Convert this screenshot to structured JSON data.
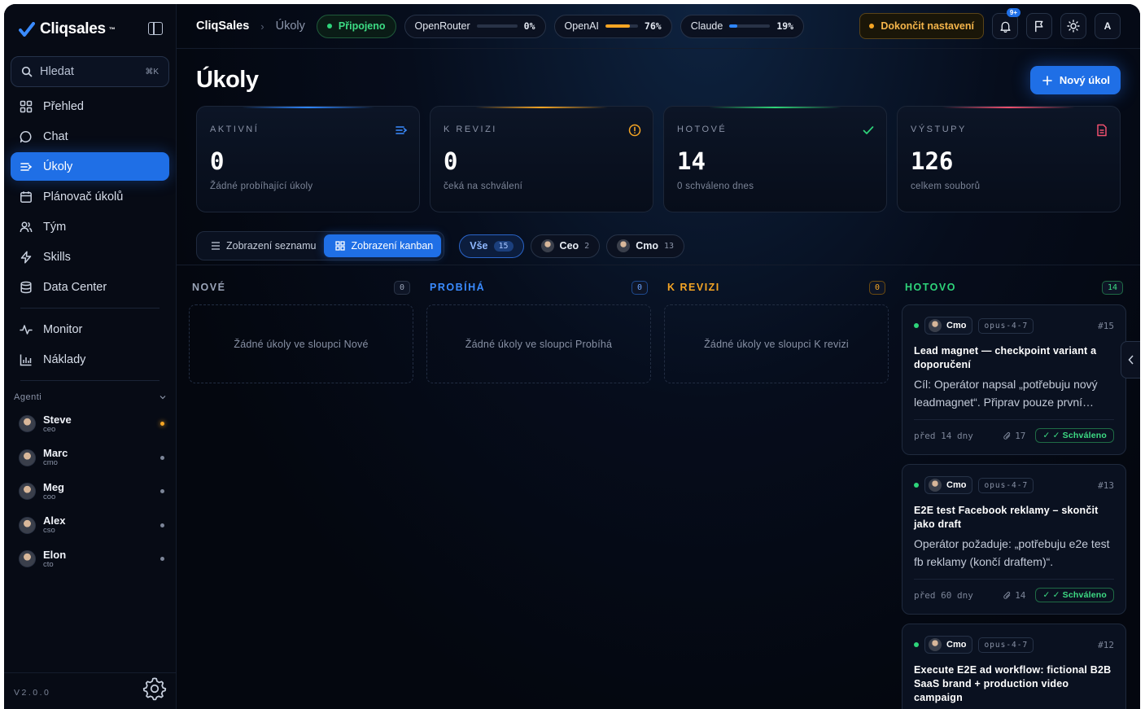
{
  "brand": {
    "name": "Cliqsales",
    "tm": "™"
  },
  "search": {
    "label": "Hledat",
    "shortcut": "⌘K"
  },
  "nav": {
    "items": [
      {
        "label": "Přehled",
        "icon": "grid-icon"
      },
      {
        "label": "Chat",
        "icon": "chat-icon"
      },
      {
        "label": "Úkoly",
        "icon": "tasks-icon",
        "active": true
      },
      {
        "label": "Plánovač úkolů",
        "icon": "calendar-icon"
      },
      {
        "label": "Tým",
        "icon": "team-icon"
      },
      {
        "label": "Skills",
        "icon": "bolt-icon"
      },
      {
        "label": "Data Center",
        "icon": "database-icon"
      }
    ],
    "items2": [
      {
        "label": "Monitor",
        "icon": "pulse-icon"
      },
      {
        "label": "Náklady",
        "icon": "chart-icon"
      }
    ]
  },
  "agents": {
    "title": "Agenti",
    "list": [
      {
        "name": "Steve",
        "role": "ceo",
        "status": "active"
      },
      {
        "name": "Marc",
        "role": "cmo",
        "status": "idle"
      },
      {
        "name": "Meg",
        "role": "coo",
        "status": "idle"
      },
      {
        "name": "Alex",
        "role": "cso",
        "status": "idle"
      },
      {
        "name": "Elon",
        "role": "cto",
        "status": "idle"
      }
    ]
  },
  "version": "V2.0.0",
  "topbar": {
    "crumb1": "CliqSales",
    "crumb2": "Úkoly",
    "connection": "Připojeno",
    "providers": [
      {
        "name": "OpenRouter",
        "pct": "0%",
        "value": 0,
        "color": "#3a7bff"
      },
      {
        "name": "OpenAI",
        "pct": "76%",
        "value": 0.76,
        "color": "#f5a524"
      },
      {
        "name": "Claude",
        "pct": "19%",
        "value": 0.19,
        "color": "#2f86ff"
      }
    ],
    "setup": "Dokončit nastavení",
    "notif_badge": "9+",
    "avatar_letter": "A"
  },
  "page": {
    "title": "Úkoly",
    "new_task": "Nový úkol"
  },
  "stats": [
    {
      "label": "AKTIVNÍ",
      "value": "0",
      "sub": "Žádné probíhající úkoly",
      "color": "#2f86ff",
      "icon": "list-icon"
    },
    {
      "label": "K REVIZI",
      "value": "0",
      "sub": "čeká na schválení",
      "color": "#f5a524",
      "icon": "alert-icon"
    },
    {
      "label": "HOTOVÉ",
      "value": "14",
      "sub": "0 schváleno dnes",
      "color": "#2ed47a",
      "icon": "check-icon"
    },
    {
      "label": "VÝSTUPY",
      "value": "126",
      "sub": "celkem souborů",
      "color": "#f0506e",
      "icon": "file-icon"
    }
  ],
  "view": {
    "list": "Zobrazení seznamu",
    "kanban": "Zobrazení kanban"
  },
  "filters": [
    {
      "label": "Vše",
      "count": "15",
      "selected": true
    },
    {
      "label": "Ceo",
      "count": "2"
    },
    {
      "label": "Cmo",
      "count": "13"
    }
  ],
  "columns": [
    {
      "title": "NOVÉ",
      "count": "0",
      "color": "#9aa4b8",
      "empty": "Žádné úkoly ve sloupci Nové"
    },
    {
      "title": "PROBÍHÁ",
      "count": "0",
      "color": "#3a8bff",
      "empty": "Žádné úkoly ve sloupci Probíhá"
    },
    {
      "title": "K REVIZI",
      "count": "0",
      "color": "#f5a524",
      "empty": "Žádné úkoly ve sloupci K revizi"
    },
    {
      "title": "HOTOVO",
      "count": "14",
      "color": "#2ed47a"
    }
  ],
  "cards": [
    {
      "agent": "Cmo",
      "model": "opus-4-7",
      "id": "#15",
      "title": "Lead magnet — checkpoint variant a doporučení",
      "desc": "Cíl: Operátor napsal „potřebuju nový leadmagnet“. Připrav pouze první…",
      "age": "před 14 dny",
      "files": "17",
      "status": "✓ Schváleno"
    },
    {
      "agent": "Cmo",
      "model": "opus-4-7",
      "id": "#13",
      "title": "E2E test Facebook reklamy – skončit jako draft",
      "desc": "Operátor požaduje: „potřebuju e2e test fb reklamy (končí draftem)“.",
      "age": "před 60 dny",
      "files": "14",
      "status": "✓ Schváleno"
    },
    {
      "agent": "Cmo",
      "model": "opus-4-7",
      "id": "#12",
      "title": "Execute E2E ad workflow: fictional B2B SaaS brand + production video campaign",
      "desc": "",
      "age": "",
      "files": "",
      "status": ""
    }
  ]
}
